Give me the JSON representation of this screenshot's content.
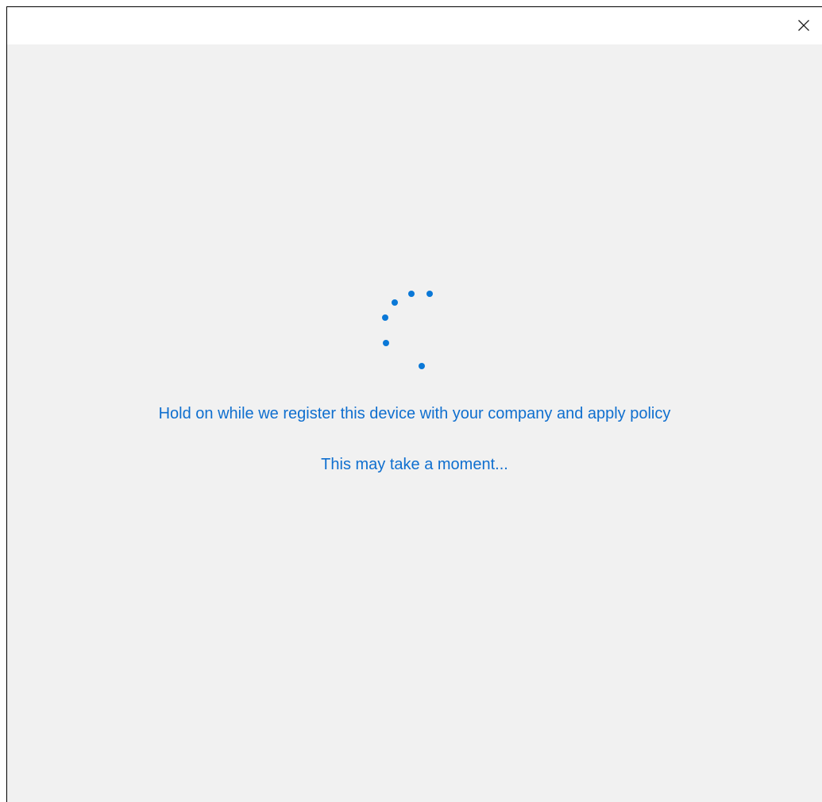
{
  "window": {
    "close_icon": "close-icon"
  },
  "content": {
    "spinner_icon": "loading-dots-spinner-icon",
    "message": "Hold on while we register this device with your company and apply policy",
    "submessage": "This may take a moment..."
  },
  "colors": {
    "accent": "#0f6fcf",
    "spinner": "#0a78d7",
    "background": "#f1f1f1",
    "titlebar": "#ffffff"
  }
}
